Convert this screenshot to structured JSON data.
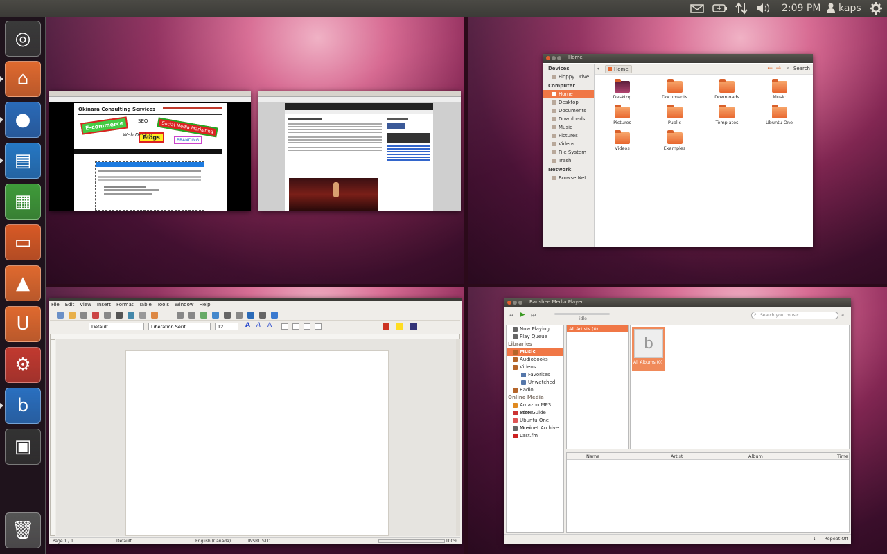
{
  "panel": {
    "time": "2:09 PM",
    "user": "kaps",
    "icons": [
      "mail-icon",
      "battery-icon",
      "network-icon",
      "volume-icon",
      "user-icon",
      "power-gear-icon"
    ]
  },
  "launcher": {
    "items": [
      {
        "name": "ubuntu-dash-icon",
        "color": "#3a3a3a",
        "glyph": "◎"
      },
      {
        "name": "home-folder-icon",
        "color": "#e06a2f",
        "glyph": "⌂"
      },
      {
        "name": "firefox-icon",
        "color": "#2a6ab8",
        "glyph": "●"
      },
      {
        "name": "writer-icon",
        "color": "#2678c4",
        "glyph": "▤"
      },
      {
        "name": "calc-icon",
        "color": "#3f9b3a",
        "glyph": "▦"
      },
      {
        "name": "impress-icon",
        "color": "#d85a26",
        "glyph": "▭"
      },
      {
        "name": "software-center-icon",
        "color": "#e06a2f",
        "glyph": "▲"
      },
      {
        "name": "ubuntu-one-icon",
        "color": "#e06a2f",
        "glyph": "U"
      },
      {
        "name": "system-settings-icon",
        "color": "#c23a30",
        "glyph": "⚙"
      },
      {
        "name": "banshee-icon",
        "color": "#2a70c0",
        "glyph": "b"
      },
      {
        "name": "workspace-switcher-icon",
        "color": "#333333",
        "glyph": "▣"
      },
      {
        "name": "trash-icon",
        "color": "#555555",
        "glyph": "🗑"
      }
    ]
  },
  "browser1": {
    "site_title": "Okinara Consulting Services",
    "tag_words": [
      "SEO",
      "Blogs",
      "Social Media Marketing",
      "BRANDING",
      "Web Design",
      "E-commerce"
    ]
  },
  "browser2": {},
  "file_manager": {
    "title": "Home",
    "location": "Home",
    "search": "Search",
    "sidebar": [
      {
        "type": "header",
        "label": "Devices"
      },
      {
        "type": "item",
        "label": "Floppy Drive"
      },
      {
        "type": "header",
        "label": "Computer"
      },
      {
        "type": "item",
        "label": "Home",
        "selected": true
      },
      {
        "type": "item",
        "label": "Desktop"
      },
      {
        "type": "item",
        "label": "Documents"
      },
      {
        "type": "item",
        "label": "Downloads"
      },
      {
        "type": "item",
        "label": "Music"
      },
      {
        "type": "item",
        "label": "Pictures"
      },
      {
        "type": "item",
        "label": "Videos"
      },
      {
        "type": "item",
        "label": "File System"
      },
      {
        "type": "item",
        "label": "Trash"
      },
      {
        "type": "header",
        "label": "Network"
      },
      {
        "type": "item",
        "label": "Browse Net..."
      }
    ],
    "folders": [
      "Desktop",
      "Documents",
      "Downloads",
      "Music",
      "Pictures",
      "Public",
      "Templates",
      "Ubuntu One",
      "Videos",
      "Examples"
    ]
  },
  "writer": {
    "menus": [
      "File",
      "Edit",
      "View",
      "Insert",
      "Format",
      "Table",
      "Tools",
      "Window",
      "Help"
    ],
    "style": "Default",
    "font": "Liberation Serif",
    "size": "12",
    "status": {
      "page": "Page 1 / 1",
      "style": "Default",
      "lang": "English (Canada)",
      "insrt": "INSRT",
      "std": "STD",
      "zoom": "100%"
    }
  },
  "banshee": {
    "title": "Banshee Media Player",
    "search_placeholder": "Search your music",
    "idle": "idle",
    "sources": [
      {
        "label": "Now Playing",
        "indent": 1,
        "color": "#666"
      },
      {
        "label": "Play Queue",
        "indent": 1,
        "color": "#666"
      },
      {
        "label": "Libraries",
        "header": true
      },
      {
        "label": "Music",
        "indent": 1,
        "selected": true,
        "color": "#b5652a"
      },
      {
        "label": "Audiobooks",
        "indent": 1,
        "color": "#b5652a"
      },
      {
        "label": "Videos",
        "indent": 1,
        "color": "#b5652a"
      },
      {
        "label": "Favorites",
        "indent": 2,
        "color": "#5577aa"
      },
      {
        "label": "Unwatched",
        "indent": 2,
        "color": "#5577aa"
      },
      {
        "label": "Radio",
        "indent": 1,
        "color": "#b5652a"
      },
      {
        "label": "Online Media",
        "header": true
      },
      {
        "label": "Amazon MP3 Store",
        "indent": 1,
        "color": "#e08a20"
      },
      {
        "label": "Miro Guide",
        "indent": 1,
        "color": "#c33"
      },
      {
        "label": "Ubuntu One Music...",
        "indent": 1,
        "color": "#d55"
      },
      {
        "label": "Internet Archive",
        "indent": 1,
        "color": "#666"
      },
      {
        "label": "Last.fm",
        "indent": 1,
        "color": "#c22"
      }
    ],
    "artists_label": "All Artists (0)",
    "albums_label": "All Albums (0)",
    "columns": [
      "Name",
      "Artist",
      "Album",
      "Time"
    ],
    "repeat": "Repeat Off"
  }
}
